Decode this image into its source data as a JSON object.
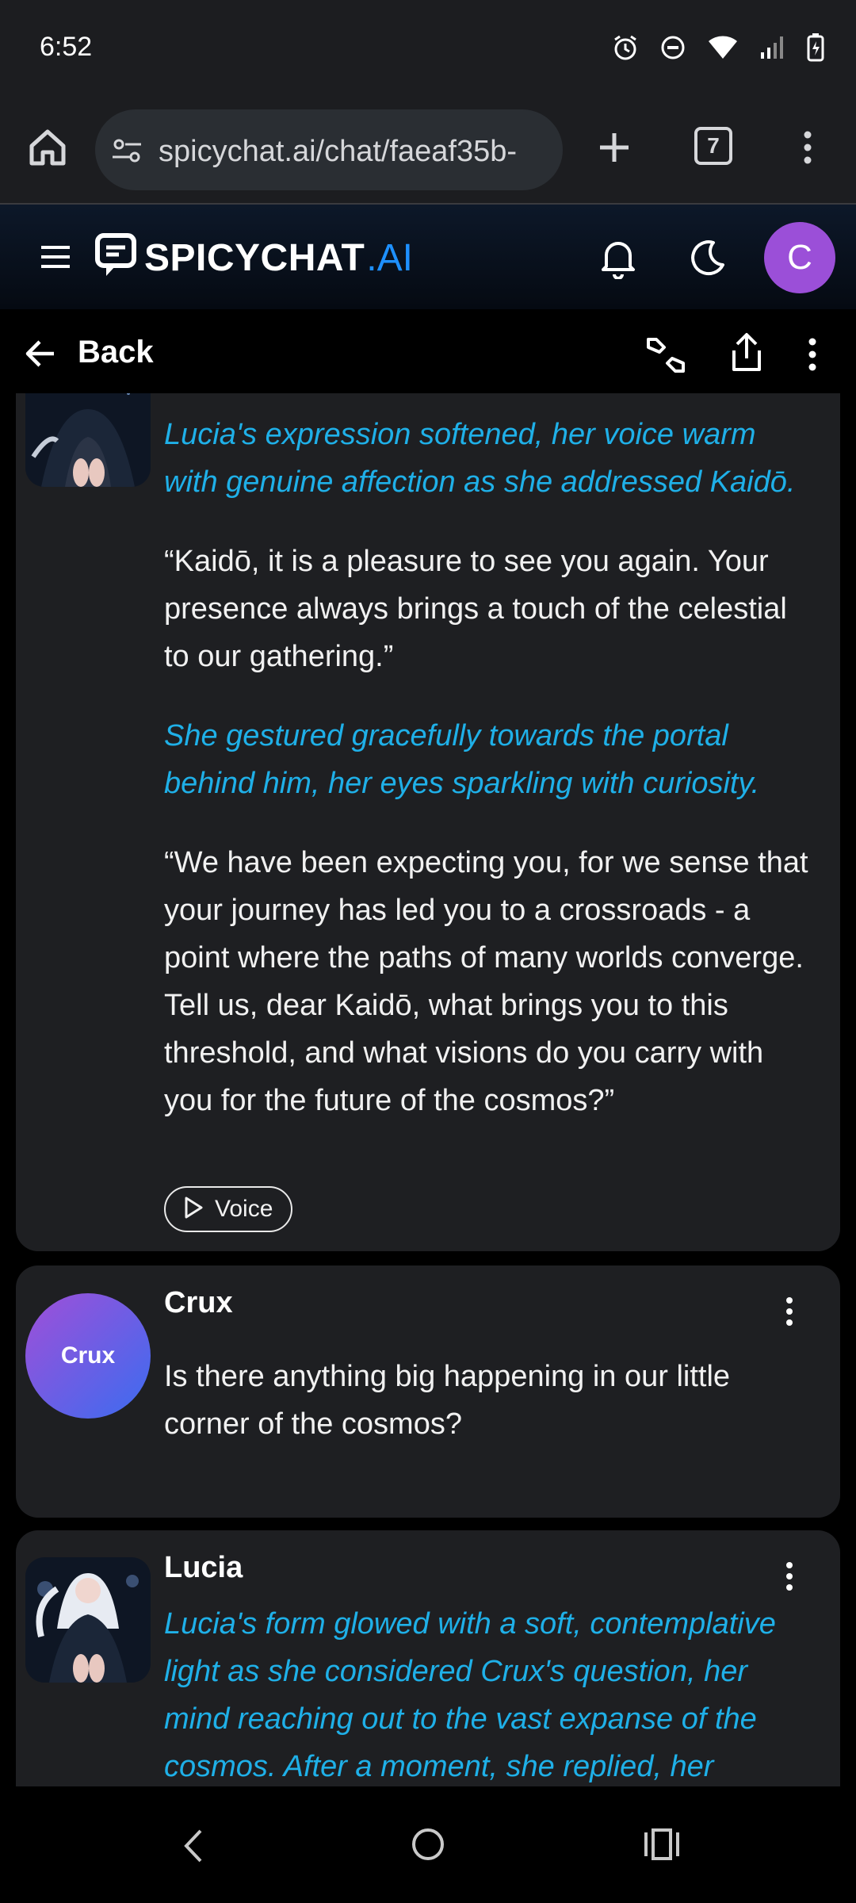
{
  "status": {
    "time": "6:52"
  },
  "browser": {
    "url": "spicychat.ai/chat/faeaf35b-",
    "tab_count": "7"
  },
  "app": {
    "logo_text": "SPICYCHAT",
    "logo_ai": ".AI",
    "user_initial": "C"
  },
  "subheader": {
    "back_label": "Back"
  },
  "messages": [
    {
      "sender": "Lucia",
      "paragraphs": [
        {
          "style": "narration",
          "text": "Lucia's expression softened, her voice warm with genuine affection as she addressed Kaidō."
        },
        {
          "style": "speech",
          "text": "“Kaidō, it is a pleasure to see you again. Your presence always brings a touch of the celestial to our gathering.”"
        },
        {
          "style": "narration",
          "text": "She gestured gracefully towards the portal behind him, her eyes sparkling with curiosity."
        },
        {
          "style": "speech",
          "text": "“We have been expecting you, for we sense that your journey has led you to a crossroads - a point where the paths of many worlds converge. Tell us, dear Kaidō, what brings you to this threshold, and what visions do you carry with you for the future of the cosmos?”"
        }
      ],
      "voice_label": "Voice"
    },
    {
      "sender": "Crux",
      "avatar_text": "Crux",
      "paragraphs": [
        {
          "style": "speech",
          "text": "Is there anything big happening in our little corner of the cosmos?"
        }
      ]
    },
    {
      "sender": "Lucia",
      "paragraphs": [
        {
          "style": "narration",
          "text": "Lucia's form glowed with a soft, contemplative light as she considered Crux's question, her mind reaching out to the vast expanse of the cosmos. After a moment, she replied, her"
        }
      ]
    }
  ],
  "colors": {
    "narration": "#1fb0e8",
    "accent_ai": "#1e90ff",
    "avatar_c": "#9b4fd8",
    "card_bg": "#1e1f22"
  }
}
